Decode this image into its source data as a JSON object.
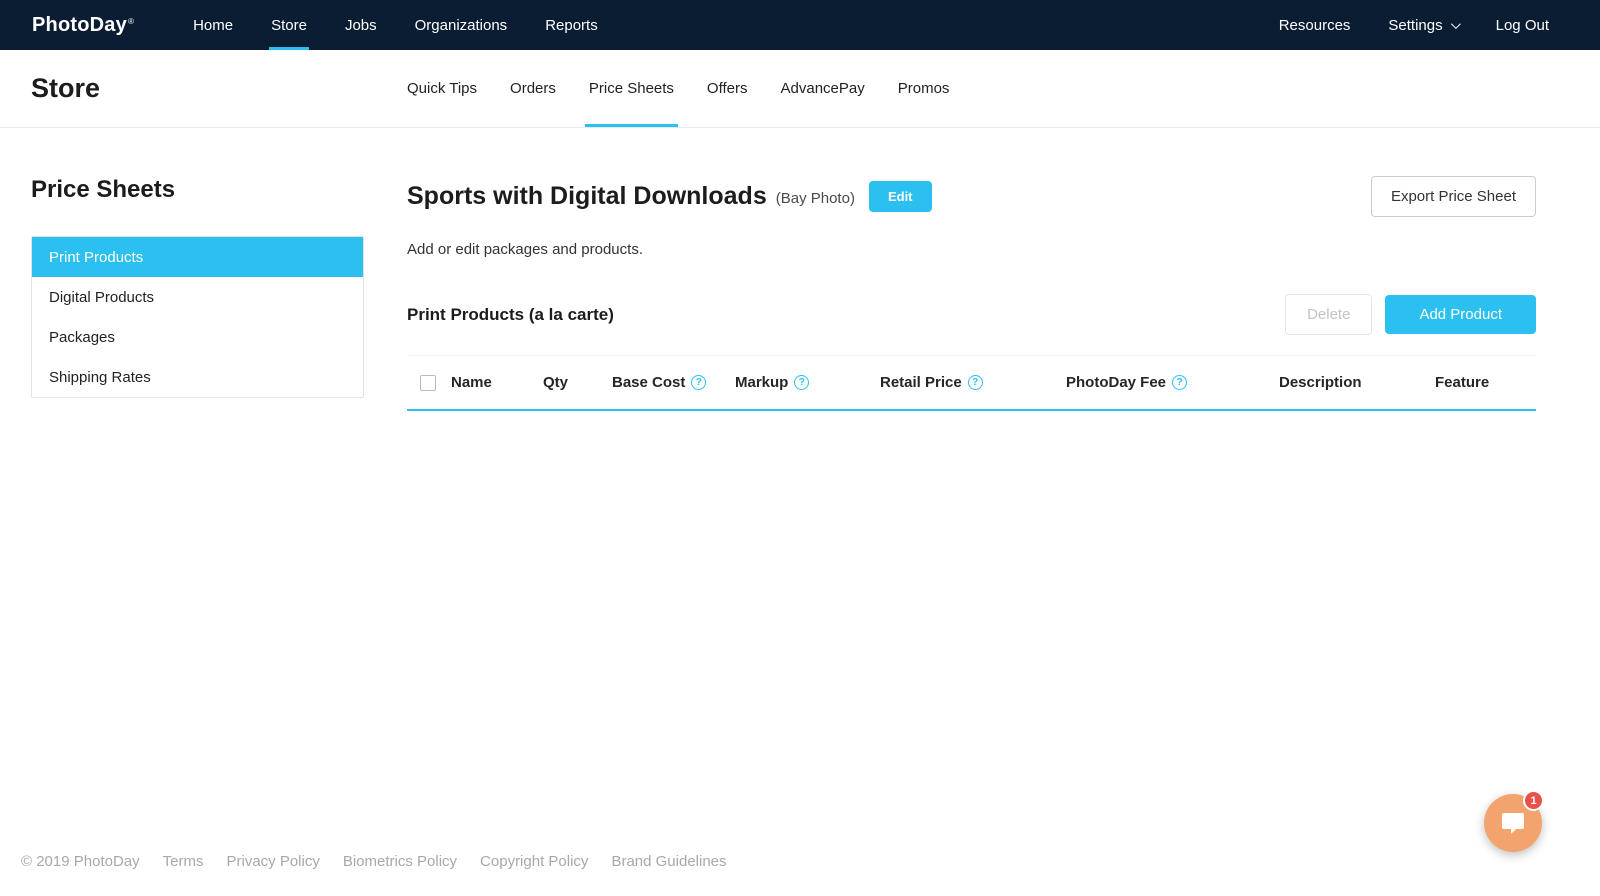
{
  "colors": {
    "accent": "#2bc0f0",
    "navbar_bg": "#0a1d33",
    "chat_bg": "#f3a36d",
    "badge_bg": "#e8504a"
  },
  "icons": {
    "help": "?",
    "chevron": "chevron-down",
    "chat": "speech-bubble"
  },
  "navbar": {
    "brand": "PhotoDay",
    "brand_mark": "®",
    "items": [
      {
        "label": "Home",
        "active": false
      },
      {
        "label": "Store",
        "active": true
      },
      {
        "label": "Jobs",
        "active": false
      },
      {
        "label": "Organizations",
        "active": false
      },
      {
        "label": "Reports",
        "active": false
      }
    ],
    "right": [
      {
        "label": "Resources"
      },
      {
        "label": "Settings"
      },
      {
        "label": "Log Out"
      }
    ]
  },
  "subheader": {
    "title": "Store",
    "tabs": [
      {
        "label": "Quick Tips",
        "active": false
      },
      {
        "label": "Orders",
        "active": false
      },
      {
        "label": "Price Sheets",
        "active": true
      },
      {
        "label": "Offers",
        "active": false
      },
      {
        "label": "AdvancePay",
        "active": false
      },
      {
        "label": "Promos",
        "active": false
      }
    ]
  },
  "sidebar": {
    "title": "Price Sheets",
    "items": [
      {
        "label": "Print Products",
        "active": true
      },
      {
        "label": "Digital Products",
        "active": false
      },
      {
        "label": "Packages",
        "active": false
      },
      {
        "label": "Shipping Rates",
        "active": false
      }
    ]
  },
  "main": {
    "sheet_title": "Sports with Digital Downloads",
    "sheet_subtitle": "(Bay Photo)",
    "edit_label": "Edit",
    "export_label": "Export Price Sheet",
    "description": "Add or edit packages and products.",
    "section_title": "Print Products (a la carte)",
    "delete_label": "Delete",
    "add_product_label": "Add Product",
    "table": {
      "columns": [
        {
          "label": "Name",
          "help": false
        },
        {
          "label": "Qty",
          "help": false
        },
        {
          "label": "Base Cost",
          "help": true
        },
        {
          "label": "Markup",
          "help": true
        },
        {
          "label": "Retail Price",
          "help": true
        },
        {
          "label": "PhotoDay Fee",
          "help": true
        },
        {
          "label": "Description",
          "help": false
        },
        {
          "label": "Feature",
          "help": false
        }
      ],
      "rows": []
    }
  },
  "footer": {
    "items": [
      "© 2019 PhotoDay",
      "Terms",
      "Privacy Policy",
      "Biometrics Policy",
      "Copyright Policy",
      "Brand Guidelines"
    ]
  },
  "chat": {
    "badge": "1"
  }
}
